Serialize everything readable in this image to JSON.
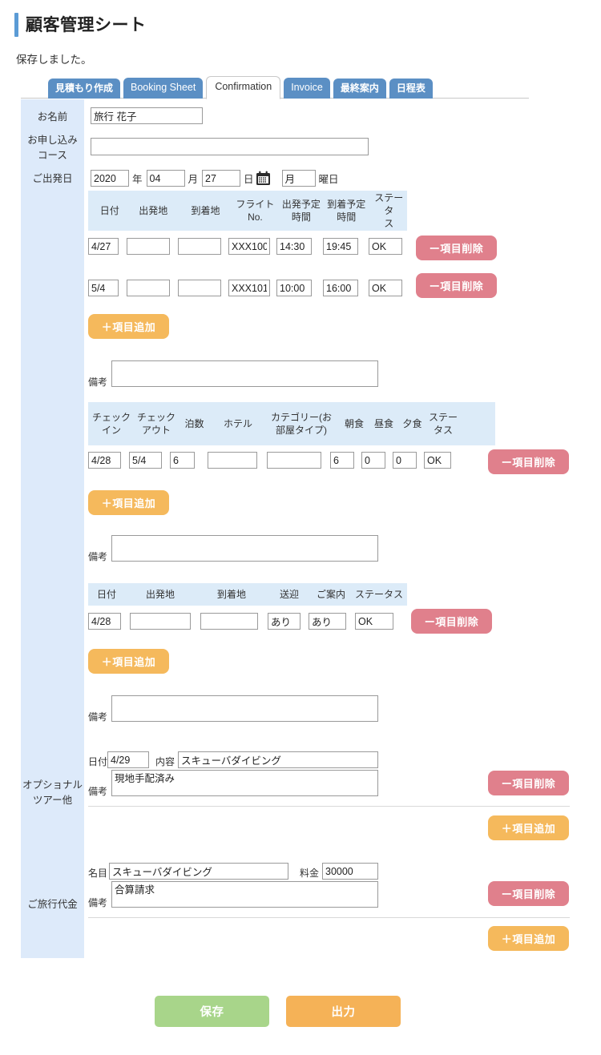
{
  "header": {
    "title": "顧客管理シート",
    "flash_message": "保存しました。"
  },
  "tabs": [
    {
      "label": "見積もり作成",
      "active": false
    },
    {
      "label": "Booking Sheet",
      "active": false
    },
    {
      "label": "Confirmation",
      "active": true
    },
    {
      "label": "Invoice",
      "active": false
    },
    {
      "label": "最終案内",
      "active": false
    },
    {
      "label": "日程表",
      "active": false
    }
  ],
  "fields": {
    "name_label": "お名前",
    "name_value": "旅行 花子",
    "course_label_line1": "お申し込み",
    "course_label_line2": "コース",
    "course_value": "",
    "departure_label": "ご出発日",
    "year_value": "2020",
    "year_unit": "年",
    "month_value": "04",
    "month_unit": "月",
    "day_value": "27",
    "day_unit": "日",
    "weekday_value": "月",
    "weekday_unit": "曜日",
    "calendar_icon": "calendar-icon"
  },
  "flight_table": {
    "headers": [
      "日付",
      "出発地",
      "到着地",
      "フライト\nNo.",
      "出発予定\n時間",
      "到着予定\n時間",
      "ステータ\nス"
    ],
    "headers_split": [
      [
        "日付",
        ""
      ],
      [
        "出発地",
        ""
      ],
      [
        "到着地",
        ""
      ],
      [
        "フライト",
        "No."
      ],
      [
        "出発予定",
        "時間"
      ],
      [
        "到着予定",
        "時間"
      ],
      [
        "ステータ",
        "ス"
      ]
    ],
    "rows": [
      {
        "date": "4/27",
        "from": "",
        "to": "",
        "flight_no": "XXX100",
        "dep_time": "14:30",
        "arr_time": "19:45",
        "status": "OK"
      },
      {
        "date": "5/4",
        "from": "",
        "to": "",
        "flight_no": "XXX101",
        "dep_time": "10:00",
        "arr_time": "16:00",
        "status": "OK"
      }
    ],
    "delete_label": "ー項目削除",
    "add_label": "＋項目追加",
    "remark_label": "備考",
    "remark_value": ""
  },
  "hotel_table": {
    "headers_split": [
      [
        "チェック",
        "イン"
      ],
      [
        "チェック",
        "アウト"
      ],
      [
        "泊数",
        ""
      ],
      [
        "ホテル",
        ""
      ],
      [
        "カテゴリー(お",
        "部屋タイプ)"
      ],
      [
        "朝食",
        ""
      ],
      [
        "昼食",
        ""
      ],
      [
        "夕食",
        ""
      ],
      [
        "ステー",
        "タス"
      ]
    ],
    "rows": [
      {
        "checkin": "4/28",
        "checkout": "5/4",
        "nights": "6",
        "hotel": "",
        "category": "",
        "breakfast": "6",
        "lunch": "0",
        "dinner": "0",
        "status": "OK"
      }
    ],
    "delete_label": "ー項目削除",
    "add_label": "＋項目追加",
    "remark_label": "備考",
    "remark_value": ""
  },
  "transfer_table": {
    "headers": [
      "日付",
      "出発地",
      "到着地",
      "送迎",
      "ご案内",
      "ステータス"
    ],
    "rows": [
      {
        "date": "4/28",
        "from": "",
        "to": "",
        "transfer": "あり",
        "guide": "あり",
        "status": "OK"
      }
    ],
    "delete_label": "ー項目削除",
    "add_label": "＋項目追加",
    "remark_label": "備考",
    "remark_value": ""
  },
  "optional_tour": {
    "side_label_line1": "オプショナル",
    "side_label_line2": "ツアー他",
    "date_label": "日付",
    "date_value": "4/29",
    "content_label": "内容",
    "content_value": "スキューバダイビング",
    "remark_label": "備考",
    "remark_value": "現地手配済み",
    "delete_label": "ー項目削除",
    "add_label": "＋項目追加"
  },
  "travel_fee": {
    "side_label": "ご旅行代金",
    "item_label": "名目",
    "item_value": "スキューバダイビング",
    "price_label": "料金",
    "price_value": "30000",
    "remark_label": "備考",
    "remark_value": "合算請求",
    "delete_label": "ー項目削除",
    "add_label": "＋項目追加"
  },
  "footer": {
    "save_label": "保存",
    "output_label": "出力"
  },
  "colors": {
    "tab_blue": "#5b8fc4",
    "sidebar_blue": "#ddeafa",
    "table_header_blue": "#dcebf8",
    "delete_pink": "#e0808c",
    "add_orange": "#f5b95c",
    "save_green": "#a8d58a",
    "output_orange": "#f5b257",
    "title_accent": "#5b9bd5"
  }
}
